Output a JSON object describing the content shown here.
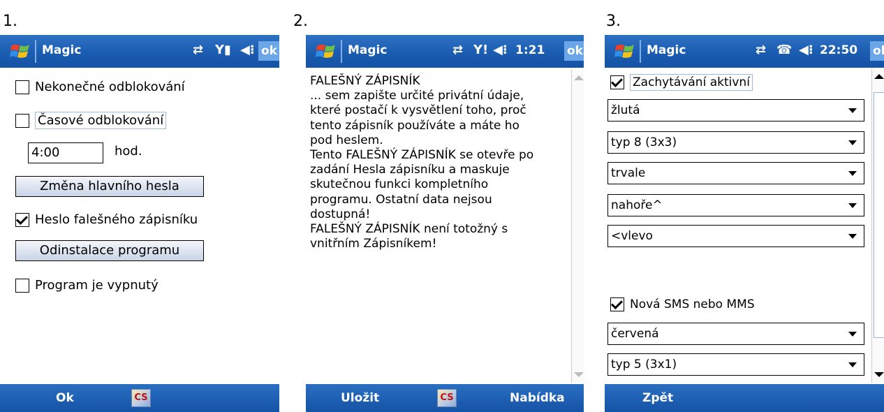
{
  "labels": {
    "one": "1.",
    "two": "2.",
    "three": "3."
  },
  "colors": {
    "titlebar": "#1a5cb0",
    "ok_button": "#6aa6e8",
    "accent_red": "#c01010"
  },
  "icons": [
    "windows-flag-icon",
    "sync-icon",
    "signal-icon",
    "speaker-icon"
  ],
  "screen1": {
    "title": "Magic",
    "ok": "ok",
    "items": {
      "unlimited": "Nekonečné odblokování",
      "timed": "Časové odblokování",
      "hours_value": "4:00",
      "hours_unit": "hod.",
      "change_pw": "Změna hlavního hesla",
      "fake_pw": "Heslo falešného zápisníku",
      "uninstall": "Odinstalace programu",
      "off": "Program je vypnutý"
    },
    "checked": {
      "unlimited": false,
      "timed": false,
      "fake_pw": true,
      "off": false
    },
    "bottom": {
      "left": "Ok",
      "cs": "CS"
    }
  },
  "screen2": {
    "title": "Magic",
    "time": "1:21",
    "ok": "ok",
    "lines": [
      "FALEŠNÝ ZÁPISNÍK",
      "... sem zapište určité privátní údaje,",
      "které postačí k vysvětlení toho, proč",
      "tento zápisník používáte a máte ho",
      "pod heslem.",
      "Tento FALEŠNÝ ZÁPISNÍK se otevře po",
      "zadání Hesla zápisníku a maskuje",
      "skutečnou funkci kompletního",
      "programu. Ostatní data nejsou",
      "dostupná!",
      "FALEŠNÝ ZÁPISNÍK není totožný s",
      "vnitřním Zápisníkem!"
    ],
    "bottom": {
      "left": "Uložit",
      "cs": "CS",
      "right": "Nabídka"
    }
  },
  "screen3": {
    "title": "Magic",
    "time": "22:50",
    "ok": "ok",
    "capture_label": "Zachytávání aktivní",
    "capture_checked": true,
    "selects1": [
      "žlutá",
      "typ 8 (3x3)",
      "trvale",
      "nahoře^",
      "<vlevo"
    ],
    "sms_label": "Nová SMS nebo MMS",
    "sms_checked": true,
    "selects2": [
      "červená",
      "typ 5 (3x1)"
    ],
    "bottom": {
      "left": "Zpět"
    }
  }
}
